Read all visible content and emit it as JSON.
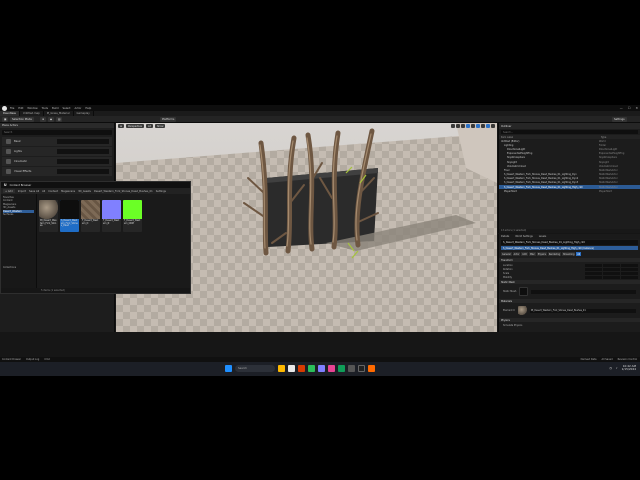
{
  "app": {
    "menu": [
      "File",
      "Edit",
      "Window",
      "Tools",
      "Build",
      "Select",
      "Actor",
      "Help"
    ],
    "tabs": [
      "Dauntless",
      "Untitled.map",
      "M_Grass_Material",
      "Gameplay"
    ],
    "window_controls": [
      "—",
      "☐",
      "✕"
    ]
  },
  "toolbar": {
    "mode_label": "Selection Mode",
    "platforms_label": "Platforms",
    "settings_label": "Settings"
  },
  "left_panel": {
    "header": "Place Actors",
    "search_placeholder": "Search",
    "rows": [
      {
        "label": "Basic",
        "color": "#7a7a7a"
      },
      {
        "label": "Lights",
        "color": "#a58a45"
      },
      {
        "label": "Cinematic",
        "color": "#6c6c6c"
      },
      {
        "label": "Visual Effects",
        "color": "#4d7db5"
      }
    ]
  },
  "content_browser": {
    "title": "Content Browser",
    "add_label": "+ Add",
    "import_label": "Import",
    "save_label": "Save All",
    "path": [
      "All",
      "Content",
      "Megascans",
      "3D_Assets",
      "Desert_Western_Fork_Stones_Dead_Bushes_01"
    ],
    "settings_label": "Settings",
    "tree": [
      "Favorites",
      "Content",
      "Megascans",
      "3D_Assets",
      "Desert_Western",
      "Surfaces",
      "Collections"
    ],
    "assets": [
      {
        "label": "MI_Desert_Western_Fork_Stones",
        "swatch": "#8c8070"
      },
      {
        "label": "S_Desert_Western_Fork_Stones_Dead",
        "swatch": "#0e0e0e"
      },
      {
        "label": "T_Desert_Western_D",
        "swatch": "#7d6a56"
      },
      {
        "label": "T_Desert_Western_N",
        "swatch": "#8080ff"
      },
      {
        "label": "T_Desert_Western_ORM",
        "swatch": "#6bff26"
      }
    ],
    "status": "5 items (1 selected)",
    "collections_label": "Collections"
  },
  "viewport": {
    "buttons": [
      "☰",
      "Perspective",
      "Lit",
      "Show"
    ],
    "grid_size": "10",
    "angle": "10°",
    "scale": "0.25",
    "cam_speed": "1"
  },
  "outliner": {
    "title": "Outliner",
    "search_placeholder": "Search...",
    "col_item": "Item Label",
    "col_type": "Type",
    "rows": [
      {
        "name": "Untitled (Editor)",
        "type": "World",
        "sel": false
      },
      {
        "name": "Lighting",
        "type": "Folder",
        "sel": false
      },
      {
        "name": "DirectionalLight",
        "type": "DirectionalLight",
        "sel": false
      },
      {
        "name": "ExponentialHeightFog",
        "type": "ExponentialHeightFog",
        "sel": false
      },
      {
        "name": "SkyAtmosphere",
        "type": "SkyAtmosphere",
        "sel": false
      },
      {
        "name": "SkyLight",
        "type": "SkyLight",
        "sel": false
      },
      {
        "name": "VolumetricCloud",
        "type": "VolumetricCloud",
        "sel": false
      },
      {
        "name": "Floor",
        "type": "StaticMeshActor",
        "sel": false
      },
      {
        "name": "S_Desert_Western_Fork_Stones_Dead_Bushes_01_Lighting_Dyn",
        "type": "StaticMeshActor",
        "sel": false
      },
      {
        "name": "S_Desert_Western_Fork_Stones_Dead_Bushes_01_Lighting_Dyn2",
        "type": "StaticMeshActor",
        "sel": false
      },
      {
        "name": "S_Desert_Western_Fork_Stones_Dead_Bushes_01_Lighting_Dyn3",
        "type": "StaticMeshActor",
        "sel": false
      },
      {
        "name": "S_Desert_Western_Fork_Stones_Dead_Bushes_01_Lighting_High_ck0",
        "type": "StaticMeshActor",
        "sel": true
      },
      {
        "name": "PlayerStart",
        "type": "PlayerStart",
        "sel": false
      }
    ],
    "footer": "13 actors (1 selected)"
  },
  "details": {
    "tabs": [
      "Details",
      "World Settings",
      "Levels"
    ],
    "actor_name": "S_Desert_Western_Fork_Stones_Dead_Bushes_01_Lighting_High_ck0",
    "component": "S_Desert_Western_Fork_Stones_Dead_Bushes_01_Lighting_High_ck0 (Instance)",
    "categories": [
      "General",
      "Actor",
      "LOD",
      "Misc",
      "Physics",
      "Rendering",
      "Streaming",
      "All"
    ],
    "transform_header": "Transform",
    "transform_rows": [
      "Location",
      "Rotation",
      "Scale",
      "Mobility"
    ],
    "mesh_header": "Static Mesh",
    "mesh_label": "Static Mesh",
    "materials_header": "Materials",
    "element_label": "Element 0",
    "material_value": "MI_Desert_Western_Fork_Stones_Dead_Bushes_01",
    "physics_header": "Physics",
    "simulate_label": "Simulate Physics"
  },
  "status_bar": {
    "items": [
      "Content Drawer",
      "Output Log",
      "Cmd",
      "Derived Data",
      "All Saved",
      "Revision Control"
    ]
  },
  "taskbar": {
    "search_placeholder": "Search",
    "time": "10:42 AM",
    "date": "1/15/2024",
    "icon_colors": [
      "#1f8fff",
      "#ffb900",
      "#e8e8e8",
      "#d83b01",
      "#2bbf5a",
      "#7f7fff",
      "#e84393",
      "#0f9d58",
      "#555555",
      "#222222",
      "#ff6a00"
    ]
  }
}
